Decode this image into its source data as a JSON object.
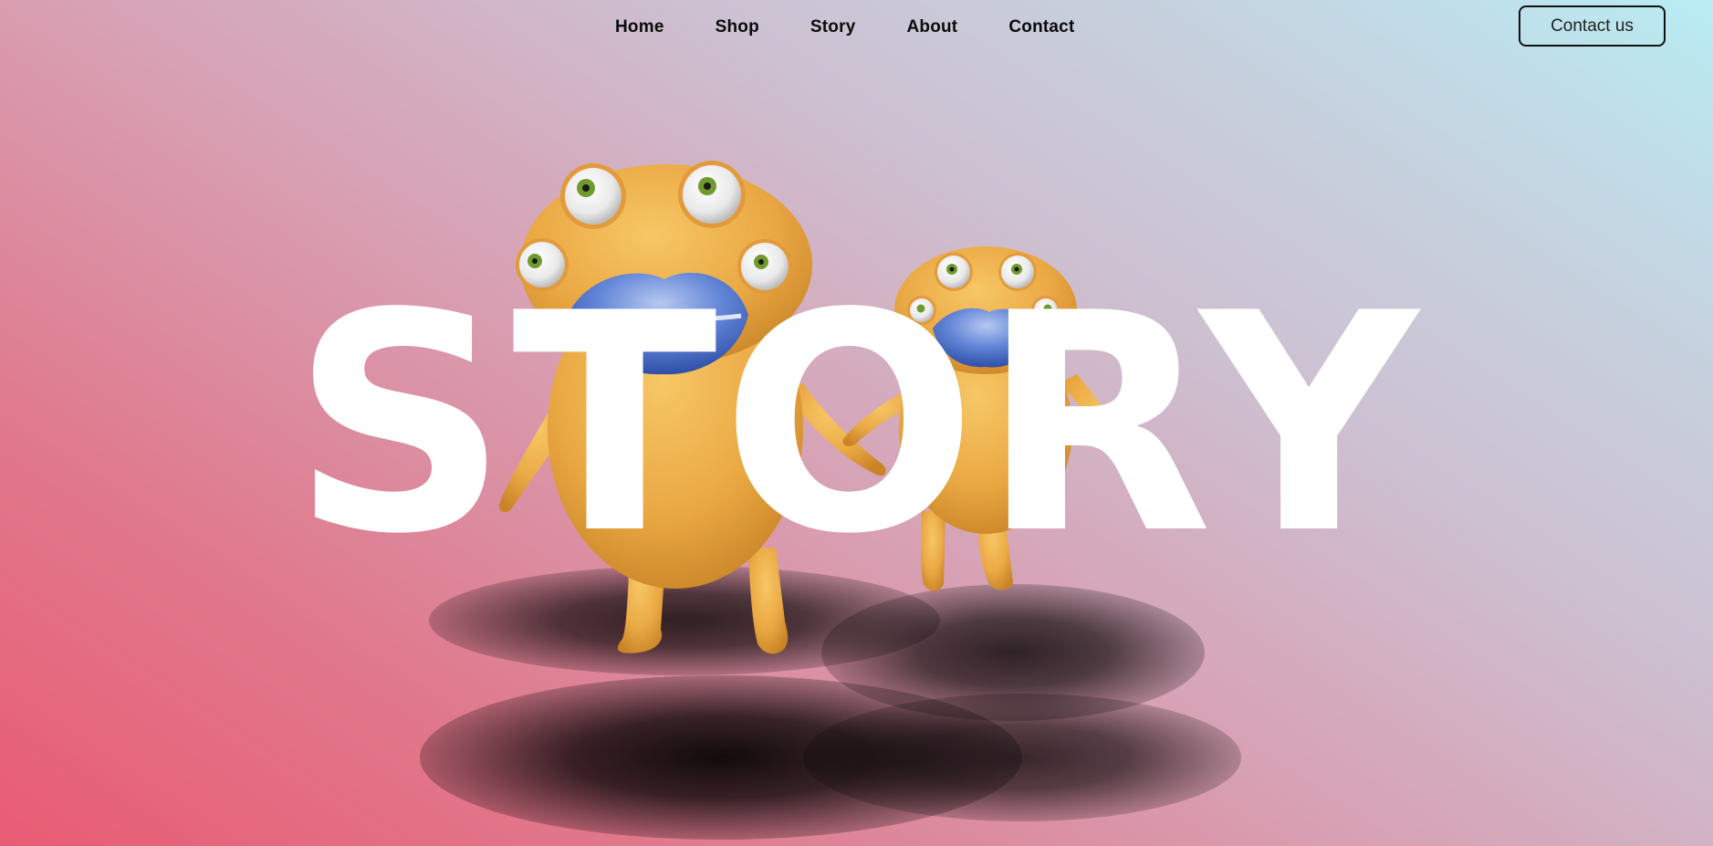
{
  "nav": {
    "links": [
      {
        "label": "Home"
      },
      {
        "label": "Shop"
      },
      {
        "label": "Story"
      },
      {
        "label": "About"
      },
      {
        "label": "Contact"
      }
    ],
    "cta_label": "Contact us"
  },
  "hero": {
    "title": "STORY"
  },
  "colors": {
    "gradient_start": "#e95c74",
    "gradient_end": "#b9ecf3",
    "monster_body": "#f0b24a",
    "monster_lips": "#5a7fd6",
    "title_text": "#ffffff"
  },
  "icons": {
    "large_monster": "yellow-monster-character",
    "small_monster": "yellow-monster-character"
  }
}
